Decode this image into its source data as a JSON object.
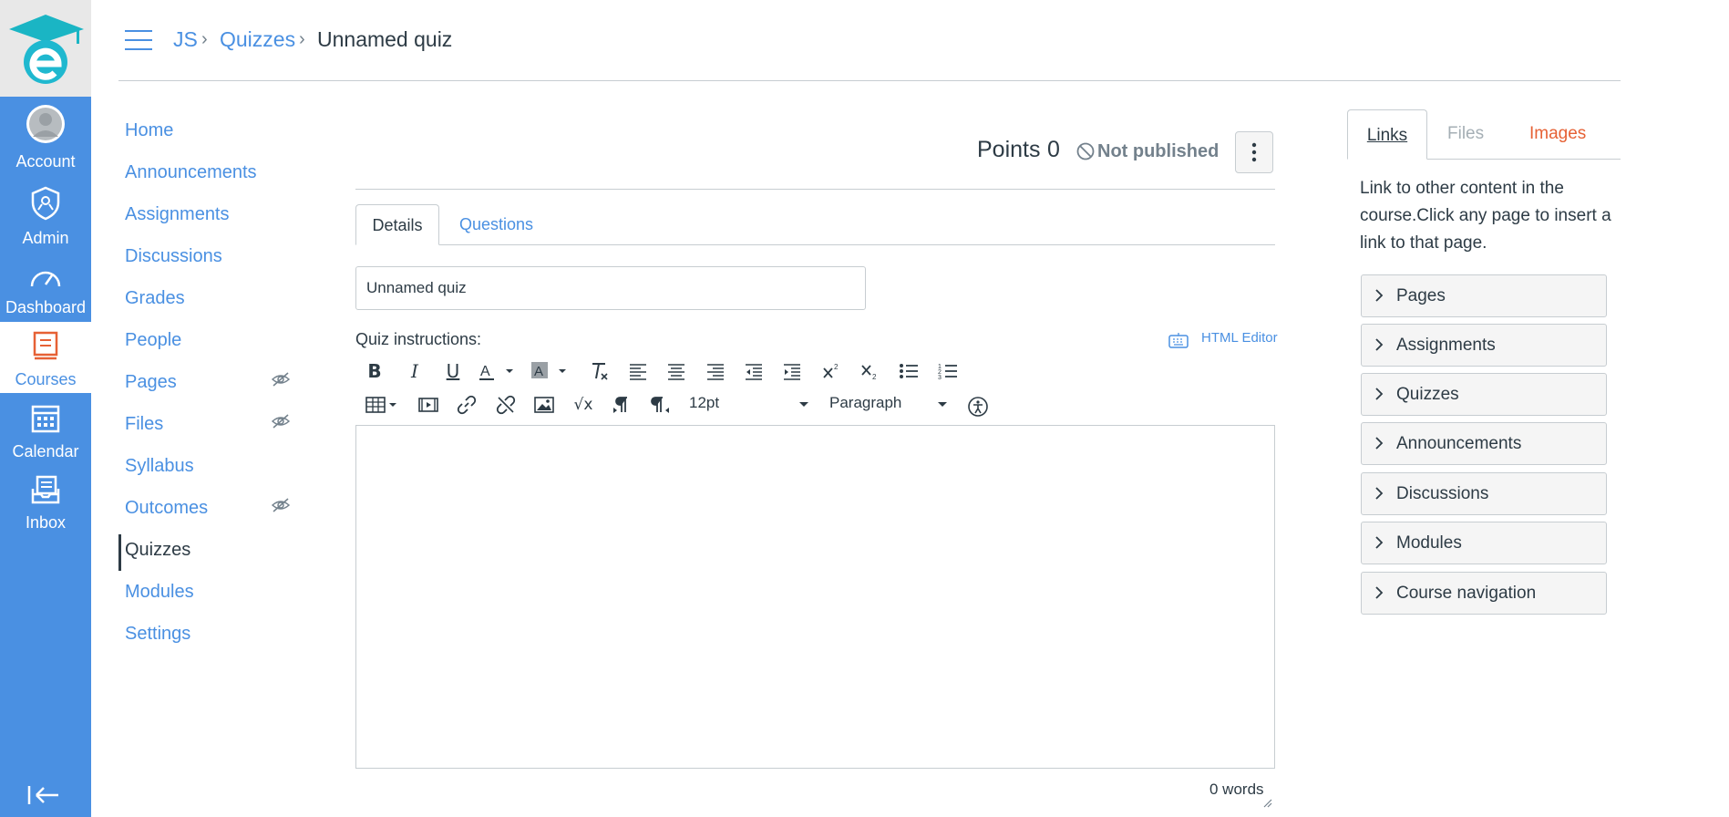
{
  "global_nav": {
    "items": [
      {
        "label": "Account",
        "icon": "avatar-icon"
      },
      {
        "label": "Admin",
        "icon": "admin-shield-icon"
      },
      {
        "label": "Dashboard",
        "icon": "dashboard-gauge-icon"
      },
      {
        "label": "Courses",
        "icon": "courses-book-icon"
      },
      {
        "label": "Calendar",
        "icon": "calendar-icon"
      },
      {
        "label": "Inbox",
        "icon": "inbox-icon"
      }
    ],
    "active": "Courses",
    "colors": {
      "bg": "#4a90e2",
      "active_icon": "#e66135"
    }
  },
  "breadcrumb": [
    "JS",
    "Quizzes",
    "Unnamed quiz"
  ],
  "course_nav": {
    "items": [
      "Home",
      "Announcements",
      "Assignments",
      "Discussions",
      "Grades",
      "People",
      "Pages",
      "Files",
      "Syllabus",
      "Outcomes",
      "Quizzes",
      "Modules",
      "Settings"
    ],
    "active": "Quizzes",
    "hidden_icons_on": [
      "Pages",
      "Files",
      "Outcomes"
    ]
  },
  "quiz": {
    "points_label": "Points",
    "points_value": "0",
    "status": "Not published",
    "tabs": [
      "Details",
      "Questions"
    ],
    "title_value": "Unnamed quiz",
    "instructions_label": "Quiz instructions:",
    "html_editor_label": "HTML Editor",
    "font_size": "12pt",
    "block_format": "Paragraph",
    "word_count": "0 words"
  },
  "sidebar": {
    "tabs": [
      "Links",
      "Files",
      "Images"
    ],
    "description": "Link to other content in the course.Click any page to insert a link to that page.",
    "sections": [
      "Pages",
      "Assignments",
      "Quizzes",
      "Announcements",
      "Discussions",
      "Modules",
      "Course navigation"
    ]
  }
}
